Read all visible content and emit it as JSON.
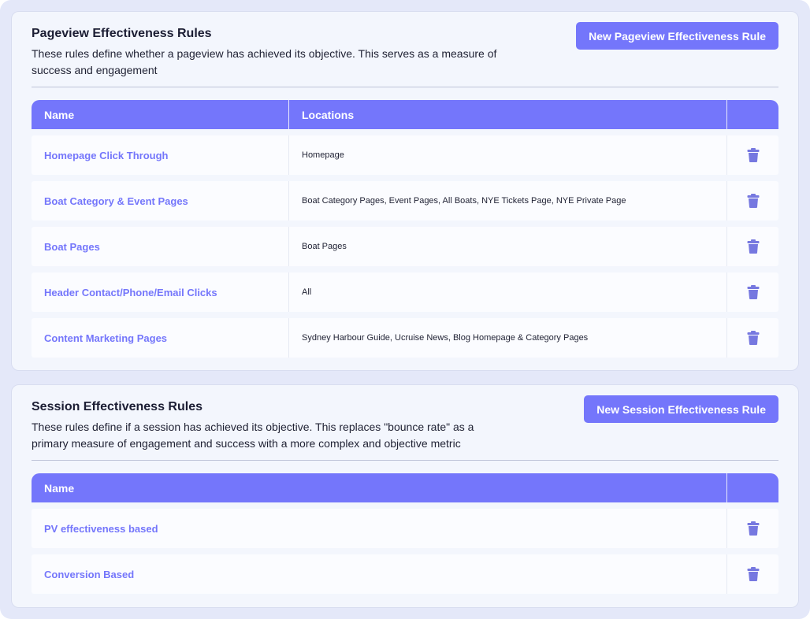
{
  "colors": {
    "accent": "#7476fb",
    "trash": "#7678e0"
  },
  "pageview": {
    "title": "Pageview Effectiveness Rules",
    "description": "These rules define whether a pageview has achieved its objective. This serves as a measure of success and engagement",
    "new_button": "New Pageview Effectiveness Rule",
    "columns": {
      "name": "Name",
      "locations": "Locations"
    },
    "rows": [
      {
        "name": "Homepage Click Through",
        "locations": "Homepage",
        "icon": "trash-icon"
      },
      {
        "name": "Boat Category & Event Pages",
        "locations": "Boat Category Pages, Event Pages, All Boats, NYE Tickets Page, NYE Private Page",
        "icon": "trash-icon"
      },
      {
        "name": "Boat Pages",
        "locations": "Boat Pages",
        "icon": "trash-icon"
      },
      {
        "name": "Header Contact/Phone/Email Clicks",
        "locations": "All",
        "icon": "trash-icon"
      },
      {
        "name": "Content Marketing Pages",
        "locations": "Sydney Harbour Guide, Ucruise News, Blog Homepage & Category Pages",
        "icon": "trash-icon"
      }
    ]
  },
  "session": {
    "title": "Session Effectiveness Rules",
    "description": "These rules define if a session has achieved its objective. This replaces \"bounce rate\" as a primary measure of engagement and success with a more complex and objective metric",
    "new_button": "New Session Effectiveness Rule",
    "columns": {
      "name": "Name"
    },
    "rows": [
      {
        "name": "PV effectiveness based",
        "icon": "trash-icon"
      },
      {
        "name": "Conversion Based",
        "icon": "trash-icon"
      }
    ]
  }
}
